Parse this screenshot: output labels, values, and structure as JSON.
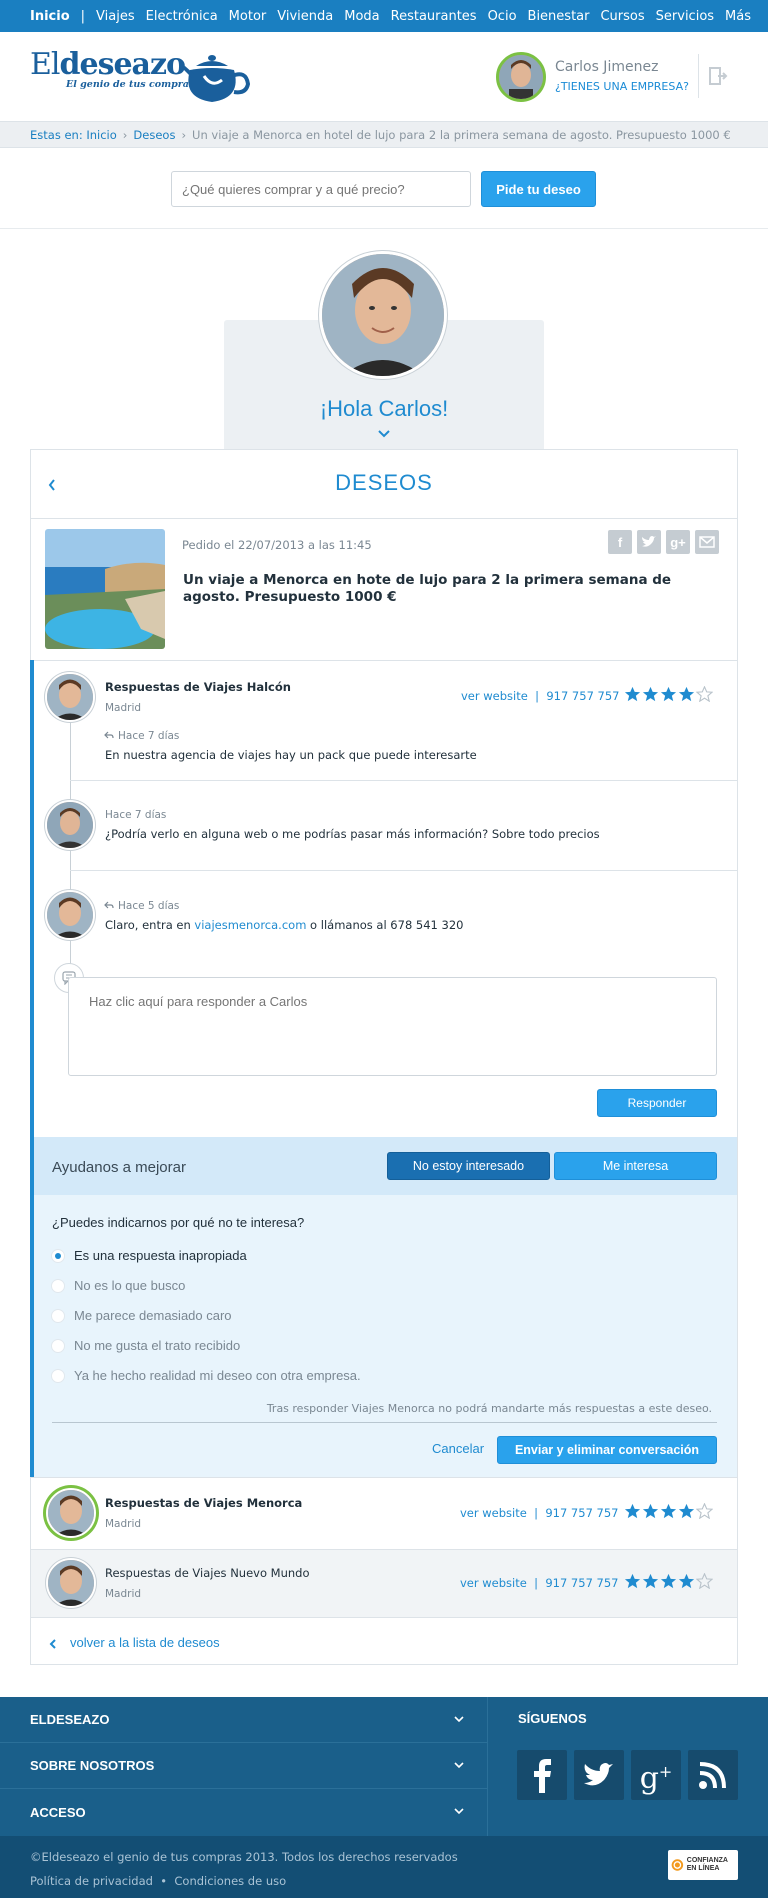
{
  "nav": {
    "items": [
      "Inicio",
      "Viajes",
      "Electrónica",
      "Motor",
      "Vivienda",
      "Moda",
      "Restaurantes",
      "Ocio",
      "Bienestar",
      "Cursos",
      "Servicios",
      "Más"
    ],
    "separator": "|"
  },
  "header": {
    "logo_main_light": "El",
    "logo_main_bold": "deseazo",
    "logo_tagline": "El genio de tus compras",
    "user_name": "Carlos Jimenez",
    "company_link": "¿TIENES UNA EMPRESA?"
  },
  "breadcrumb": {
    "prefix": "Estas en:",
    "items": [
      "Inicio",
      "Deseos",
      "Un viaje a Menorca en hotel de lujo para 2 la primera semana de agosto. Presupuesto 1000 €"
    ],
    "separator": "›"
  },
  "search": {
    "placeholder": "¿Qué quieres comprar y a qué precio?",
    "button": "Pide tu deseo"
  },
  "hola": {
    "greeting": "¡Hola Carlos!"
  },
  "deseos": {
    "title": "DESEOS",
    "wish": {
      "date": "Pedido el 22/07/2013 a las 11:45",
      "title": "Un viaje a Menorca en hote de lujo para 2 la primera semana de agosto. Presupuesto 1000 €",
      "share_icons": [
        "facebook-icon",
        "twitter-icon",
        "googleplus-icon",
        "mail-icon"
      ]
    }
  },
  "conversation": {
    "provider": {
      "name": "Respuestas de Viajes Halcón",
      "city": "Madrid",
      "website": "ver website",
      "sep": "|",
      "phone": "917 757 757",
      "rating": 4,
      "rating_max": 5
    },
    "messages": [
      {
        "time": "Hace 7 días",
        "text": "En nuestra agencia de viajes hay un pack que puede interesarte",
        "reply_icon": true
      },
      {
        "time": "Hace 7 días",
        "text": "¿Podría verlo en alguna web o me podrías pasar más información? Sobre todo precios",
        "reply_icon": false
      },
      {
        "time": "Hace 5 días",
        "text_before": "Claro, entra en ",
        "link": "viajesmenorca.com",
        "text_after": " o llámanos al 678 541 320",
        "reply_icon": true
      }
    ],
    "reply_placeholder": "Haz clic aquí para responder a Carlos",
    "reply_button": "Responder"
  },
  "feedback": {
    "title": "Ayudanos a mejorar",
    "btn_not_interested": "No estoy interesado",
    "btn_interested": "Me interesa",
    "question": "¿Puedes indicarnos por qué no te interesa?",
    "options": [
      "Es una respuesta inapropiada",
      "No es lo que busco",
      "Me parece demasiado caro",
      "No me gusta el trato recibido",
      "Ya he hecho realidad mi deseo con otra empresa."
    ],
    "selected_index": 0,
    "note": "Tras responder Viajes Menorca no podrá mandarte más respuestas a este deseo.",
    "cancel": "Cancelar",
    "send": "Enviar y eliminar conversación"
  },
  "other_providers": [
    {
      "name": "Respuestas de Viajes Menorca",
      "city": "Madrid",
      "website": "ver website",
      "sep": "|",
      "phone": "917 757 757",
      "rating": 4,
      "rating_max": 5
    },
    {
      "name": "Respuestas de Viajes Nuevo Mundo",
      "city": "Madrid",
      "website": "ver website",
      "sep": "|",
      "phone": "917 757 757",
      "rating": 4,
      "rating_max": 5
    }
  ],
  "back_link": "volver a la lista de deseos",
  "footer": {
    "sections": [
      "ELDESEAZO",
      "SOBRE NOSOTROS",
      "ACCESO"
    ],
    "follow": "SÍGUENOS",
    "social": [
      "facebook-icon",
      "twitter-icon",
      "googleplus-icon",
      "rss-icon"
    ],
    "copyright": "©Eldeseazo el genio de tus compras 2013. Todos los derechos reservados",
    "privacy": "Política de privacidad",
    "dot": "•",
    "conditions": "Condiciones de uso",
    "trust_badge": "CONFIANZA EN LÍNEA"
  },
  "colors": {
    "nav": "#1a7fc1",
    "accent": "#1f8bd0",
    "button": "#2aa2ec",
    "button_dark": "#1a6fb1",
    "feedback_head": "#d3e9f9",
    "feedback_body": "#e8f4fc",
    "avatar_ring": "#7bc143",
    "footer": "#1a5f8a"
  }
}
